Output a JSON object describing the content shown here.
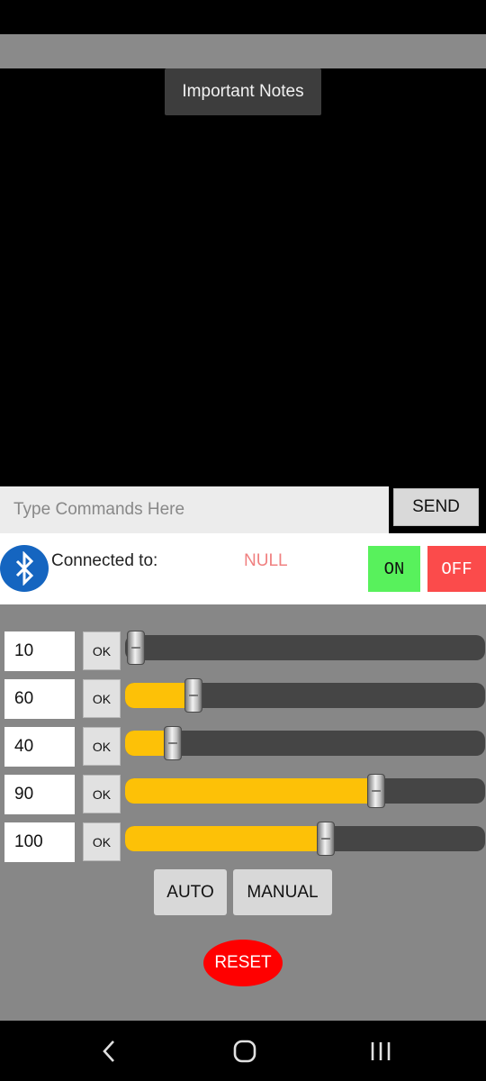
{
  "header": {
    "notes_button": "Important Notes"
  },
  "command": {
    "placeholder": "Type Commands Here",
    "value": "",
    "send_label": "SEND"
  },
  "bluetooth": {
    "connected_label": "Connected to:",
    "device": "NULL",
    "on_label": "ON",
    "off_label": "OFF",
    "icon": "bluetooth-icon"
  },
  "sliders": [
    {
      "value": "10",
      "ok_label": "OK",
      "level": 0.0
    },
    {
      "value": "60",
      "ok_label": "OK",
      "level": 0.17
    },
    {
      "value": "40",
      "ok_label": "OK",
      "level": 0.11
    },
    {
      "value": "90",
      "ok_label": "OK",
      "level": 0.71
    },
    {
      "value": "100",
      "ok_label": "OK",
      "level": 0.56
    }
  ],
  "modes": {
    "auto_label": "AUTO",
    "manual_label": "MANUAL"
  },
  "reset_label": "RESET",
  "nav": {
    "back_icon": "back-icon",
    "home_icon": "home-icon",
    "recents_icon": "recents-icon"
  },
  "colors": {
    "accent": "#fdc107",
    "on": "#58f15c",
    "off": "#fb4b4b",
    "reset": "#ff0000",
    "bluetooth": "#1565c0"
  }
}
